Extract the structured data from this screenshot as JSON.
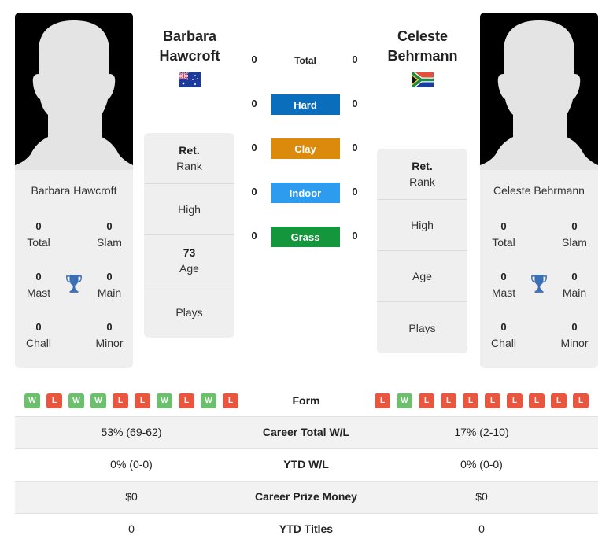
{
  "player1": {
    "name_line1": "Barbara",
    "name_line2": "Hawcroft",
    "full_name": "Barbara Hawcroft",
    "flag": "australia-flag",
    "titles": {
      "total": {
        "value": "0",
        "label": "Total"
      },
      "slam": {
        "value": "0",
        "label": "Slam"
      },
      "mast": {
        "value": "0",
        "label": "Mast"
      },
      "main": {
        "value": "0",
        "label": "Main"
      },
      "chall": {
        "value": "0",
        "label": "Chall"
      },
      "minor": {
        "value": "0",
        "label": "Minor"
      }
    },
    "rank_panel": {
      "rank_value": "Ret.",
      "rank_label": "Rank",
      "high_label": "High",
      "age_value": "73",
      "age_label": "Age",
      "plays_label": "Plays"
    },
    "form": [
      "W",
      "L",
      "W",
      "W",
      "L",
      "L",
      "W",
      "L",
      "W",
      "L"
    ]
  },
  "player2": {
    "name_line1": "Celeste",
    "name_line2": "Behrmann",
    "full_name": "Celeste Behrmann",
    "flag": "south-africa-flag",
    "titles": {
      "total": {
        "value": "0",
        "label": "Total"
      },
      "slam": {
        "value": "0",
        "label": "Slam"
      },
      "mast": {
        "value": "0",
        "label": "Mast"
      },
      "main": {
        "value": "0",
        "label": "Main"
      },
      "chall": {
        "value": "0",
        "label": "Chall"
      },
      "minor": {
        "value": "0",
        "label": "Minor"
      }
    },
    "rank_panel": {
      "rank_value": "Ret.",
      "rank_label": "Rank",
      "high_label": "High",
      "age_label": "Age",
      "plays_label": "Plays"
    },
    "form": [
      "L",
      "W",
      "L",
      "L",
      "L",
      "L",
      "L",
      "L",
      "L",
      "L"
    ]
  },
  "surfaces": [
    {
      "label": "Total",
      "p1": "0",
      "p2": "0",
      "color": null
    },
    {
      "label": "Hard",
      "p1": "0",
      "p2": "0",
      "color": "#0a6ebd"
    },
    {
      "label": "Clay",
      "p1": "0",
      "p2": "0",
      "color": "#dc8a0c"
    },
    {
      "label": "Indoor",
      "p1": "0",
      "p2": "0",
      "color": "#2d9cef"
    },
    {
      "label": "Grass",
      "p1": "0",
      "p2": "0",
      "color": "#14973c"
    }
  ],
  "form_label": "Form",
  "stats": [
    {
      "label": "Career Total W/L",
      "p1": "53% (69-62)",
      "p2": "17% (2-10)"
    },
    {
      "label": "YTD W/L",
      "p1": "0% (0-0)",
      "p2": "0% (0-0)"
    },
    {
      "label": "Career Prize Money",
      "p1": "$0",
      "p2": "$0"
    },
    {
      "label": "YTD Titles",
      "p1": "0",
      "p2": "0"
    }
  ]
}
